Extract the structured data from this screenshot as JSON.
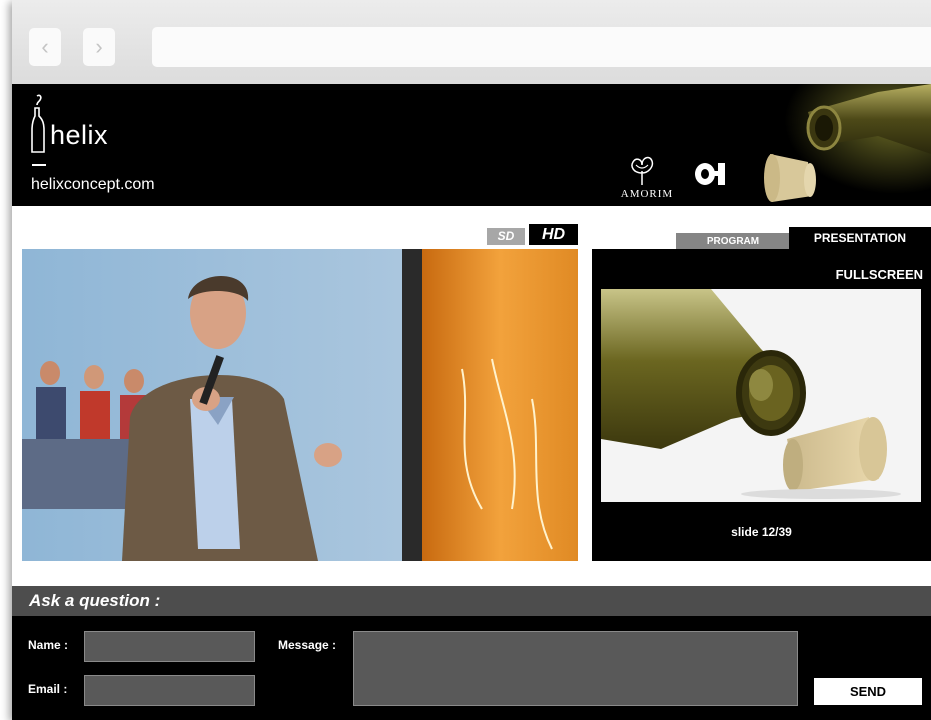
{
  "browser": {
    "back_icon": "chevron-left-icon",
    "forward_icon": "chevron-right-icon",
    "back_glyph": "‹",
    "forward_glyph": "›",
    "url": ""
  },
  "header": {
    "logo_text": "helix",
    "site_url": "helixconcept.com",
    "partner_amorim": "AMORIM",
    "partner_oi": "O-I"
  },
  "video": {
    "sd_label": "SD",
    "hd_label": "HD",
    "selected_quality": "HD"
  },
  "presentation": {
    "tabs": [
      {
        "label": "PROGRAM",
        "active": false
      },
      {
        "label": "PRESENTATION",
        "active": true
      }
    ],
    "fullscreen_label": "FULLSCREEN",
    "slide_counter": "slide 12/39"
  },
  "question_form": {
    "title": "Ask a question :",
    "name_label": "Name :",
    "email_label": "Email :",
    "message_label": "Message :",
    "name_value": "",
    "email_value": "",
    "message_value": "",
    "send_label": "SEND"
  },
  "colors": {
    "header_bg": "#000000",
    "panel_bg": "#000000",
    "ask_bar": "#4d4d4d",
    "input_bg": "#595959"
  }
}
